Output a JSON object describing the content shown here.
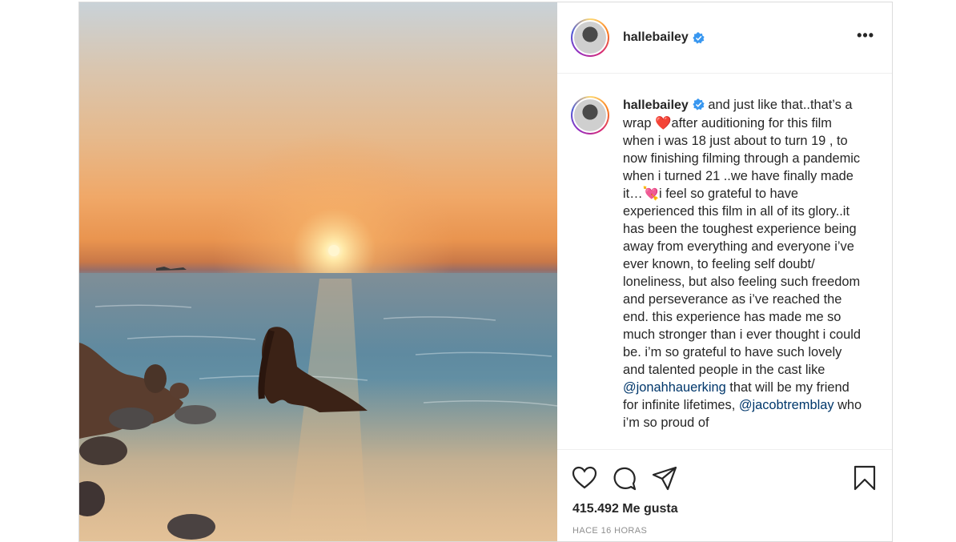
{
  "post": {
    "username": "hallebailey",
    "verified": true,
    "more_icon": "more-options-icon",
    "caption_parts": {
      "p1": " and just like that..that’s a wrap ",
      "heart1": "❤️",
      "p2": "after auditioning for this film when i was 18 just about to turn 19 , to now finishing filming through a pandemic when i turned 21 ..we have finally made it…",
      "heart2": "💘",
      "p3": "i feel so grateful to have experienced this film in all of its glory..it has been the toughest experience being away from everything and everyone i’ve ever known, to feeling self doubt/ loneliness, but also feeling such freedom and perseverance as i’ve reached the end. this experience has made me so much stronger than i ever thought i could be. i’m so grateful to have such lovely and talented people in the cast like ",
      "mention1": "@jonahhauerking",
      "p4": " that will be my friend for infinite lifetimes, ",
      "mention2": "@jacobtremblay",
      "p5": " who i’m so proud of"
    },
    "likes": "415.492 Me gusta",
    "timestamp": "HACE 16 HORAS",
    "icons": [
      "heart-icon",
      "comment-icon",
      "share-icon",
      "bookmark-icon"
    ],
    "colors": {
      "verified": "#3897f0",
      "mention": "#00376b",
      "border": "#dbdbdb"
    }
  }
}
